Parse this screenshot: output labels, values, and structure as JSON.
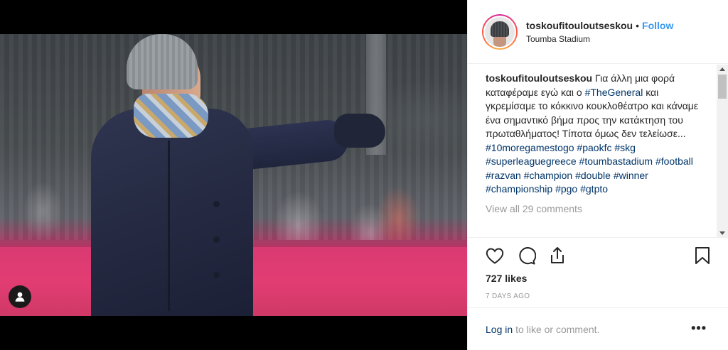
{
  "post": {
    "username": "toskoufitouloutseskou",
    "separator": "•",
    "follow_label": "Follow",
    "location": "Toumba Stadium"
  },
  "caption": {
    "username": "toskoufitouloutseskou",
    "text_1": "Για άλλη μια φορά καταφέραμε εγώ και ο",
    "tag_general": "#TheGeneral",
    "text_2": "και γκρεμίσαμε το κόκκινο κουκλοθέατρο και κάναμε ένα σημαντικό βήμα προς την κατάκτηση του πρωταθλήματος! Τίποτα όμως δεν τελείωσε...",
    "hashtags": [
      "#10moregamestogo",
      "#paokfc",
      "#skg",
      "#superleaguegreece",
      "#toumbastadium",
      "#football",
      "#razvan",
      "#champion",
      "#double",
      "#winner",
      "#championship",
      "#pgo",
      "#gtpto"
    ]
  },
  "view_comments": "View all 29 comments",
  "actions": {
    "like_icon": "heart-icon",
    "comment_icon": "comment-icon",
    "share_icon": "share-icon",
    "save_icon": "bookmark-icon"
  },
  "likes": "727 likes",
  "time": "7 DAYS AGO",
  "login": {
    "link": "Log in",
    "rest": "to like or comment.",
    "more": "•••"
  },
  "colors": {
    "link_blue": "#3897f0",
    "hashtag": "#003569",
    "text": "#262626",
    "muted": "#999999"
  }
}
